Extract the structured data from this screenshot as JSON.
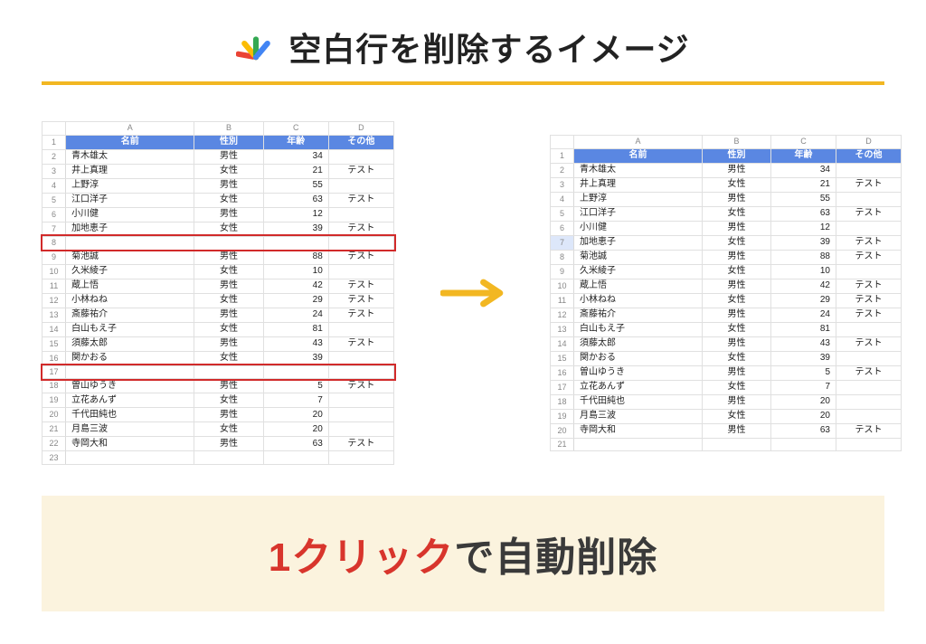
{
  "title": "空白行を削除するイメージ",
  "cols": {
    "A": "A",
    "B": "B",
    "C": "C",
    "D": "D"
  },
  "headers": {
    "name": "名前",
    "gender": "性別",
    "age": "年齢",
    "other": "その他"
  },
  "left_rows": [
    {
      "rn": "1",
      "hdr": true
    },
    {
      "rn": "2",
      "name": "青木雄太",
      "gender": "男性",
      "age": "34",
      "other": ""
    },
    {
      "rn": "3",
      "name": "井上真理",
      "gender": "女性",
      "age": "21",
      "other": "テスト"
    },
    {
      "rn": "4",
      "name": "上野淳",
      "gender": "男性",
      "age": "55",
      "other": ""
    },
    {
      "rn": "5",
      "name": "江口洋子",
      "gender": "女性",
      "age": "63",
      "other": "テスト"
    },
    {
      "rn": "6",
      "name": "小川健",
      "gender": "男性",
      "age": "12",
      "other": ""
    },
    {
      "rn": "7",
      "name": "加地恵子",
      "gender": "女性",
      "age": "39",
      "other": "テスト"
    },
    {
      "rn": "8",
      "blank": true
    },
    {
      "rn": "9",
      "name": "菊池誠",
      "gender": "男性",
      "age": "88",
      "other": "テスト"
    },
    {
      "rn": "10",
      "name": "久米綾子",
      "gender": "女性",
      "age": "10",
      "other": ""
    },
    {
      "rn": "11",
      "name": "蔵上悟",
      "gender": "男性",
      "age": "42",
      "other": "テスト"
    },
    {
      "rn": "12",
      "name": "小林ねね",
      "gender": "女性",
      "age": "29",
      "other": "テスト"
    },
    {
      "rn": "13",
      "name": "斎藤祐介",
      "gender": "男性",
      "age": "24",
      "other": "テスト"
    },
    {
      "rn": "14",
      "name": "白山もえ子",
      "gender": "女性",
      "age": "81",
      "other": ""
    },
    {
      "rn": "15",
      "name": "須藤太郎",
      "gender": "男性",
      "age": "43",
      "other": "テスト"
    },
    {
      "rn": "16",
      "name": "関かおる",
      "gender": "女性",
      "age": "39",
      "other": ""
    },
    {
      "rn": "17",
      "blank": true
    },
    {
      "rn": "18",
      "name": "曽山ゆうき",
      "gender": "男性",
      "age": "5",
      "other": "テスト"
    },
    {
      "rn": "19",
      "name": "立花あんず",
      "gender": "女性",
      "age": "7",
      "other": ""
    },
    {
      "rn": "20",
      "name": "千代田純也",
      "gender": "男性",
      "age": "20",
      "other": ""
    },
    {
      "rn": "21",
      "name": "月島三波",
      "gender": "女性",
      "age": "20",
      "other": ""
    },
    {
      "rn": "22",
      "name": "寺岡大和",
      "gender": "男性",
      "age": "63",
      "other": "テスト"
    },
    {
      "rn": "23",
      "blank": true
    }
  ],
  "right_rows": [
    {
      "rn": "1",
      "hdr": true
    },
    {
      "rn": "2",
      "name": "青木雄太",
      "gender": "男性",
      "age": "34",
      "other": ""
    },
    {
      "rn": "3",
      "name": "井上真理",
      "gender": "女性",
      "age": "21",
      "other": "テスト"
    },
    {
      "rn": "4",
      "name": "上野淳",
      "gender": "男性",
      "age": "55",
      "other": ""
    },
    {
      "rn": "5",
      "name": "江口洋子",
      "gender": "女性",
      "age": "63",
      "other": "テスト"
    },
    {
      "rn": "6",
      "name": "小川健",
      "gender": "男性",
      "age": "12",
      "other": ""
    },
    {
      "rn": "7",
      "name": "加地恵子",
      "gender": "女性",
      "age": "39",
      "other": "テスト",
      "sel": true
    },
    {
      "rn": "8",
      "name": "菊池誠",
      "gender": "男性",
      "age": "88",
      "other": "テスト"
    },
    {
      "rn": "9",
      "name": "久米綾子",
      "gender": "女性",
      "age": "10",
      "other": ""
    },
    {
      "rn": "10",
      "name": "蔵上悟",
      "gender": "男性",
      "age": "42",
      "other": "テスト"
    },
    {
      "rn": "11",
      "name": "小林ねね",
      "gender": "女性",
      "age": "29",
      "other": "テスト"
    },
    {
      "rn": "12",
      "name": "斎藤祐介",
      "gender": "男性",
      "age": "24",
      "other": "テスト"
    },
    {
      "rn": "13",
      "name": "白山もえ子",
      "gender": "女性",
      "age": "81",
      "other": ""
    },
    {
      "rn": "14",
      "name": "須藤太郎",
      "gender": "男性",
      "age": "43",
      "other": "テスト"
    },
    {
      "rn": "15",
      "name": "関かおる",
      "gender": "女性",
      "age": "39",
      "other": ""
    },
    {
      "rn": "16",
      "name": "曽山ゆうき",
      "gender": "男性",
      "age": "5",
      "other": "テスト"
    },
    {
      "rn": "17",
      "name": "立花あんず",
      "gender": "女性",
      "age": "7",
      "other": ""
    },
    {
      "rn": "18",
      "name": "千代田純也",
      "gender": "男性",
      "age": "20",
      "other": ""
    },
    {
      "rn": "19",
      "name": "月島三波",
      "gender": "女性",
      "age": "20",
      "other": ""
    },
    {
      "rn": "20",
      "name": "寺岡大和",
      "gender": "男性",
      "age": "63",
      "other": "テスト"
    },
    {
      "rn": "21",
      "blank": true
    }
  ],
  "banner": {
    "red": "1クリック",
    "dark": "で自動削除"
  }
}
